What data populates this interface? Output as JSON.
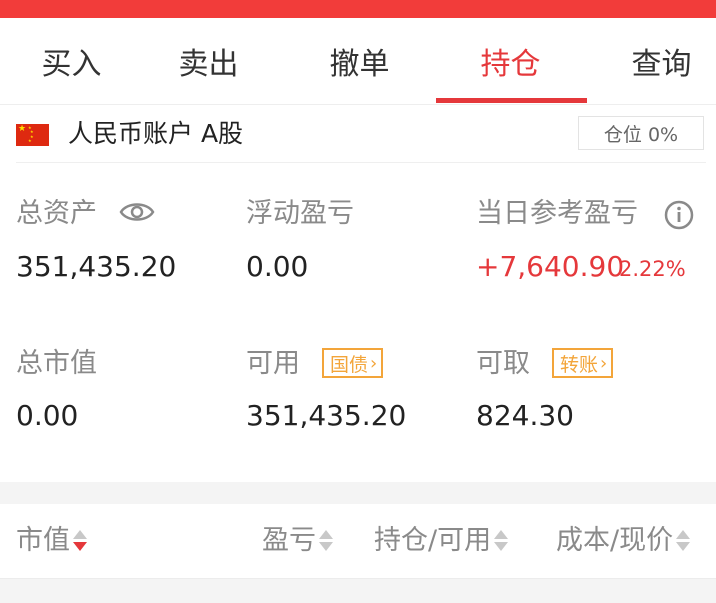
{
  "theme": {
    "accent": "#e5383b",
    "topbar": "#f23c3a",
    "tag": "#f3a53a"
  },
  "tabs": [
    {
      "label": "买入",
      "active": false
    },
    {
      "label": "卖出",
      "active": false
    },
    {
      "label": "撤单",
      "active": false
    },
    {
      "label": "持仓",
      "active": true
    },
    {
      "label": "查询",
      "active": false
    }
  ],
  "account": {
    "flag_icon": "china-flag-icon",
    "name": "人民币账户 A股",
    "position_badge": "仓位 0%"
  },
  "summary": {
    "total_assets": {
      "label": "总资产",
      "value": "351,435.20",
      "icon": "eye-icon"
    },
    "floating_pnl": {
      "label": "浮动盈亏",
      "value": "0.00"
    },
    "today_pnl": {
      "label": "当日参考盈亏",
      "value": "+7,640.90",
      "percent": "2.22%",
      "icon": "info-icon"
    },
    "market_value": {
      "label": "总市值",
      "value": "0.00"
    },
    "available": {
      "label": "可用",
      "value": "351,435.20",
      "tag": "国债"
    },
    "withdrawable": {
      "label": "可取",
      "value": "824.30",
      "tag": "转账"
    }
  },
  "table_header": {
    "col_market_value": "市值",
    "col_pnl": "盈亏",
    "col_holding": "持仓/可用",
    "col_cost": "成本/现价"
  }
}
